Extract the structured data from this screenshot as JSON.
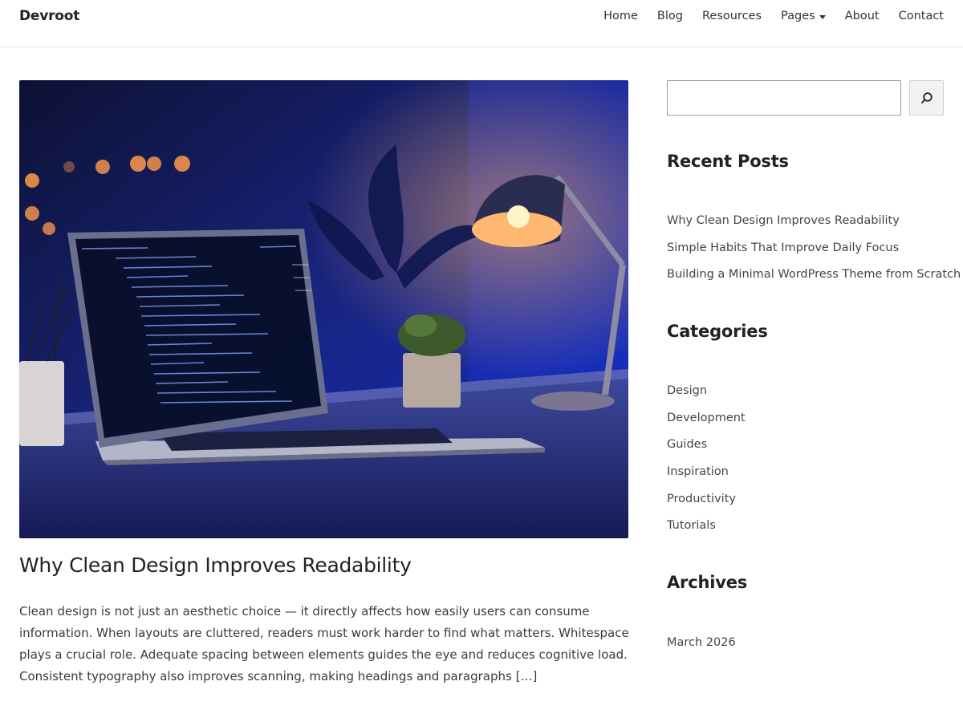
{
  "site": {
    "title": "Devroot"
  },
  "nav": {
    "items": [
      {
        "label": "Home"
      },
      {
        "label": "Blog"
      },
      {
        "label": "Resources"
      },
      {
        "label": "Pages",
        "has_dropdown": true
      },
      {
        "label": "About"
      },
      {
        "label": "Contact"
      }
    ]
  },
  "post": {
    "title": "Why Clean Design Improves Readability",
    "excerpt": "Clean design is not just an aesthetic choice — it directly affects how easily users can consume information. When layouts are cluttered, readers must work harder to find what matters. Whitespace plays a crucial role. Adequate spacing between elements guides the eye and reduces cognitive load. Consistent typography also improves scanning, making headings and paragraphs […]",
    "image_icon": "laptop-desk-photo"
  },
  "search": {
    "placeholder": "",
    "value": "",
    "button_icon": "search-icon"
  },
  "sidebar": {
    "recent_posts": {
      "title": "Recent Posts",
      "items": [
        {
          "label": "Why Clean Design Improves Readability"
        },
        {
          "label": "Simple Habits That Improve Daily Focus"
        },
        {
          "label": "Building a Minimal WordPress Theme from Scratch"
        }
      ]
    },
    "categories": {
      "title": "Categories",
      "items": [
        {
          "label": "Design"
        },
        {
          "label": "Development"
        },
        {
          "label": "Guides"
        },
        {
          "label": "Inspiration"
        },
        {
          "label": "Productivity"
        },
        {
          "label": "Tutorials"
        }
      ]
    },
    "archives": {
      "title": "Archives",
      "items": [
        {
          "label": "March 2026"
        }
      ]
    }
  },
  "colors": {
    "text": "#222222",
    "link": "#444444",
    "image_night_blue": "#1b2c8c",
    "lamp_glow": "#ffb060"
  }
}
